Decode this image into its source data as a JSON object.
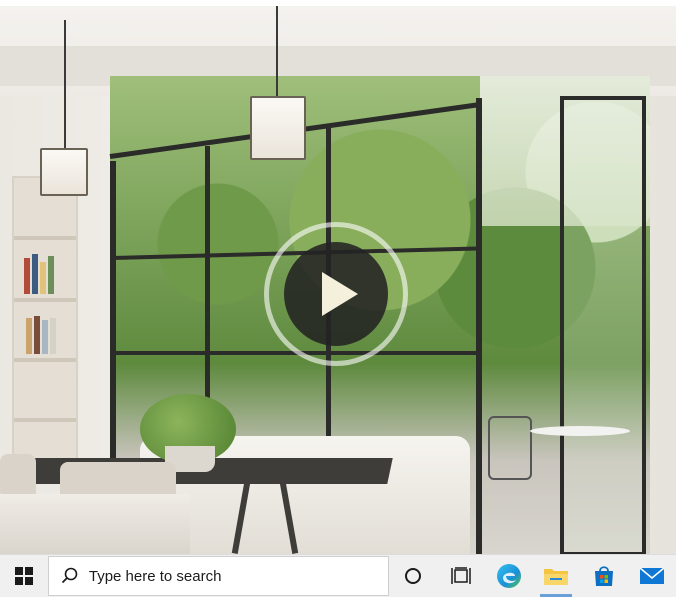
{
  "video": {
    "play_icon": "play-icon"
  },
  "taskbar": {
    "start_icon": "windows-icon",
    "search_placeholder": "Type here to search",
    "search_icon": "search-icon",
    "cortana_icon": "circle-icon",
    "task_view_icon": "task-view-icon",
    "edge_icon": "edge-icon",
    "explorer_icon": "folder-icon",
    "store_icon": "store-icon",
    "mail_icon": "mail-icon",
    "accent": "#0078d4"
  }
}
